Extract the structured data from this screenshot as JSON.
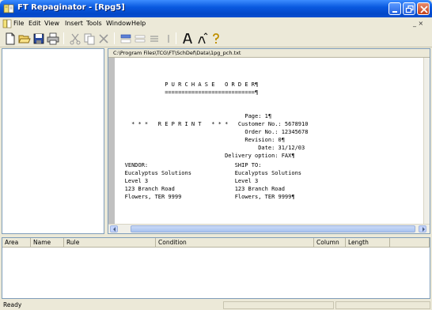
{
  "window": {
    "title": "FT Repaginator - [Rpg5]"
  },
  "menu": {
    "items": [
      "File",
      "Edit",
      "View",
      "Insert",
      "Tools",
      "Window",
      "Help"
    ],
    "mdi_controls": "_ ×"
  },
  "toolbar": {
    "buttons": [
      "new-icon",
      "open-icon",
      "save-icon",
      "print-icon",
      "cut-icon",
      "copy-icon",
      "delete-icon",
      "insert-row-icon",
      "align-icon",
      "separator-icon",
      "list-icon",
      "font-size-icon",
      "font-shrink-icon",
      "help-icon"
    ]
  },
  "document": {
    "path": "C:\\Program Files\\TCG\\FT\\SchDef\\Data\\1pg_pch.txt",
    "lines": [
      "               P U R C H A S E   O R D E R¶",
      "               ===========================¶",
      "",
      "",
      "                                       Page: 1¶",
      "     * * *   R E P R I N T   * * *   Customer No.: 5678910",
      "                                       Order No.: 12345678",
      "                                       Revision: 0¶",
      "                                           Date: 31/12/03",
      "                                 Delivery option: FAX¶",
      "   VENDOR:                          SHIP TO:",
      "   Eucalyptus Solutions             Eucalyptus Solutions",
      "   Level 3                          Level 3",
      "   123 Branch Road                  123 Branch Road",
      "   Flowers, TER 9999                Flowers, TER 9999¶"
    ]
  },
  "rules_table": {
    "columns": [
      "Area",
      "Name",
      "Rule",
      "Condition",
      "Column",
      "Length"
    ]
  },
  "status": {
    "text": "Ready"
  },
  "colors": {
    "titlebar": "#0a5ae0",
    "window_bg": "#ece9d8",
    "scroll_thumb": "#a8c2ef"
  }
}
